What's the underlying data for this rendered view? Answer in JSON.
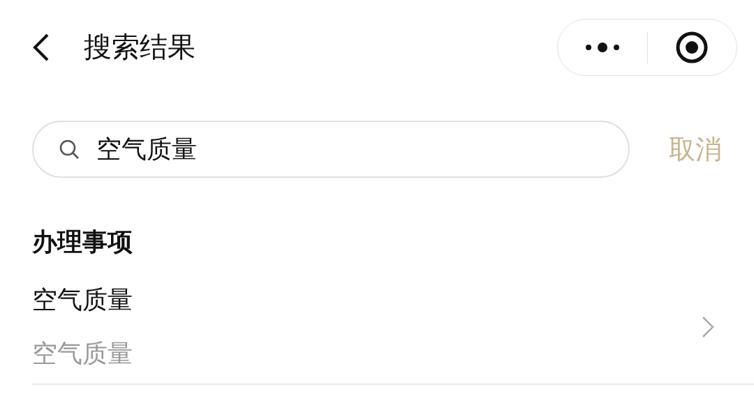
{
  "header": {
    "title": "搜索结果"
  },
  "search": {
    "value": "空气质量",
    "cancel": "取消"
  },
  "section": {
    "title": "办理事项"
  },
  "results": [
    {
      "title": "空气质量",
      "subtitle": "空气质量"
    }
  ]
}
